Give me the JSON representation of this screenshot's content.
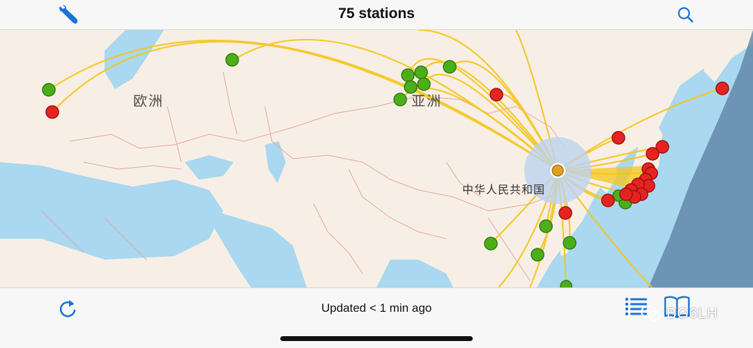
{
  "header": {
    "title": "75 stations",
    "left_icon": "wrench-icon",
    "right_icon": "search-icon"
  },
  "map": {
    "labels": {
      "europe": "欧洲",
      "asia": "亚洲",
      "china": "中华人民共和国"
    },
    "colors": {
      "sea": "#a9d8f0",
      "land": "#f7efe5",
      "border": "#e6a3a3",
      "path": "#f5c518",
      "station_ok": "#4caf1a",
      "station_fail": "#e52421",
      "home": "#e0a020"
    }
  },
  "footer": {
    "status": "Updated < 1 min ago",
    "left_icon": "refresh-icon",
    "right_icons": [
      "list-icon",
      "book-icon"
    ],
    "watermark": "BG6LH"
  }
}
